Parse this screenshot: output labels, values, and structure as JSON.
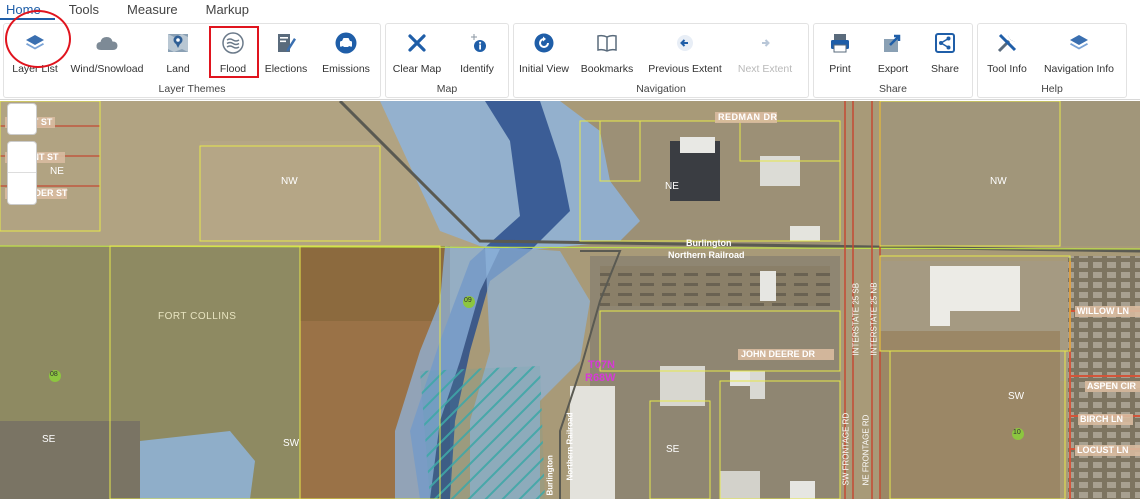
{
  "tabs": [
    {
      "label": "Home",
      "active": true
    },
    {
      "label": "Tools",
      "active": false
    },
    {
      "label": "Measure",
      "active": false
    },
    {
      "label": "Markup",
      "active": false
    }
  ],
  "groups": {
    "layer_themes": {
      "label": "Layer Themes",
      "buttons": [
        {
          "label": "Layer List",
          "icon": "layers-icon"
        },
        {
          "label": "Wind/Snowload",
          "icon": "cloud-icon"
        },
        {
          "label": "Land",
          "icon": "map-pin-icon"
        },
        {
          "label": "Flood",
          "icon": "flood-waves-icon"
        },
        {
          "label": "Elections",
          "icon": "ballot-pencil-icon"
        },
        {
          "label": "Emissions",
          "icon": "car-icon"
        }
      ]
    },
    "map": {
      "label": "Map",
      "buttons": [
        {
          "label": "Clear Map",
          "icon": "x-icon"
        },
        {
          "label": "Identify",
          "icon": "identify-info-icon"
        }
      ]
    },
    "navigation": {
      "label": "Navigation",
      "buttons": [
        {
          "label": "Initial View",
          "icon": "refresh-icon"
        },
        {
          "label": "Bookmarks",
          "icon": "book-icon"
        },
        {
          "label": "Previous Extent",
          "icon": "arrow-left-icon"
        },
        {
          "label": "Next Extent",
          "icon": "arrow-right-icon"
        }
      ]
    },
    "share": {
      "label": "Share",
      "buttons": [
        {
          "label": "Print",
          "icon": "printer-icon"
        },
        {
          "label": "Export",
          "icon": "export-icon"
        },
        {
          "label": "Share",
          "icon": "share-icon"
        }
      ]
    },
    "help": {
      "label": "Help",
      "buttons": [
        {
          "label": "Tool Info",
          "icon": "tools-icon"
        },
        {
          "label": "Navigation Info",
          "icon": "layers-icon"
        }
      ]
    }
  },
  "map_labels": {
    "redman_dr": "REDMAN DR",
    "lt_st": "LT ST",
    "liant_st": "LIANT ST",
    "sader_st": "SADER ST",
    "ne_left": "NE",
    "nw_1": "NW",
    "ne_mid": "NE",
    "nw_right": "NW",
    "burlington_1": "Burlington",
    "northern_railroad_1": "Northern Railroad",
    "fort_collins": "FORT COLLINS",
    "sec_09": "09",
    "sec_08": "08",
    "sec_10": "10",
    "t07n": "T07N",
    "r68w": "R68W",
    "john_deere_dr": "JOHN DEERE DR",
    "interstate_25_sb": "INTERSTATE 25 SB",
    "interstate_25_nb": "INTERSTATE 25 NB",
    "sw_frontage_rd": "SW FRONTAGE RD",
    "ne_frontage_rd": "NE FRONTAGE RD",
    "willow_ln": "WILLOW LN",
    "aspen_cir": "ASPEN CIR",
    "birch_ln": "BIRCH LN",
    "locust_ln": "LOCUST LN",
    "sw_right": "SW",
    "sw_left": "SW",
    "se_left": "SE",
    "se_mid": "SE",
    "burlington_2": "Burlington",
    "northern_railroad_2": "Northern Railroad"
  },
  "colors": {
    "accent": "#1f5ea8",
    "highlight": "#e0141e",
    "flood_light": "#8fb4dc",
    "flood_dark": "#2b4f8c",
    "parcel_line": "#e6e84a",
    "road": "#c44a33"
  }
}
